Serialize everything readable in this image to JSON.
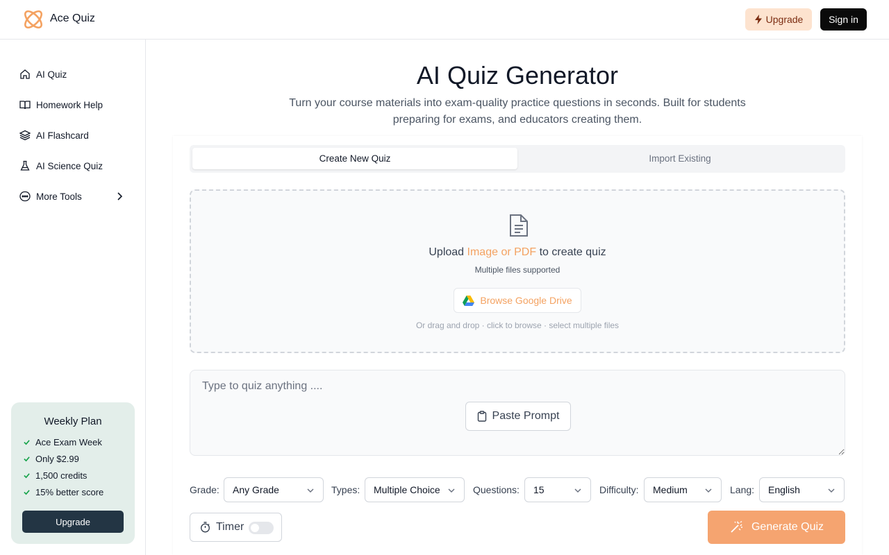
{
  "header": {
    "brand": "Ace Quiz",
    "upgrade_label": "Upgrade",
    "signin_label": "Sign in",
    "accent_color": "#f4a261"
  },
  "sidebar": {
    "items": [
      {
        "label": "AI Quiz",
        "icon": "home-icon"
      },
      {
        "label": "Homework Help",
        "icon": "book-open-icon"
      },
      {
        "label": "AI Flashcard",
        "icon": "layers-icon"
      },
      {
        "label": "AI Science Quiz",
        "icon": "flask-icon"
      },
      {
        "label": "More Tools",
        "icon": "more-circle-icon"
      }
    ],
    "plan": {
      "title": "Weekly Plan",
      "features": [
        "Ace Exam Week",
        "Only $2.99",
        "1,500 credits",
        "15% better score"
      ],
      "button_label": "Upgrade"
    }
  },
  "main": {
    "title": "AI Quiz Generator",
    "subtitle": "Turn your course materials into exam-quality practice questions in seconds. Built for students preparing for exams, and educators creating them.",
    "tabs": [
      {
        "label": "Create New Quiz",
        "active": true
      },
      {
        "label": "Import Existing",
        "active": false
      }
    ],
    "upload": {
      "prefix": "Upload ",
      "accent": "Image or PDF",
      "suffix": " to create quiz",
      "multi": "Multiple files supported",
      "drive_label": "Browse Google Drive",
      "drag_hint": "Or drag and drop · click to browse · select multiple files"
    },
    "prompt": {
      "placeholder": "Type to quiz anything ....",
      "value": "",
      "paste_label": "Paste Prompt"
    },
    "options": {
      "grade": {
        "label": "Grade:",
        "value": "Any Grade"
      },
      "types": {
        "label": "Types:",
        "value": "Multiple Choice"
      },
      "questions": {
        "label": "Questions:",
        "value": "15"
      },
      "difficulty": {
        "label": "Difficulty:",
        "value": "Medium"
      },
      "lang": {
        "label": "Lang:",
        "value": "English"
      }
    },
    "timer": {
      "label": "Timer",
      "enabled": false
    },
    "generate_label": "Generate Quiz"
  }
}
